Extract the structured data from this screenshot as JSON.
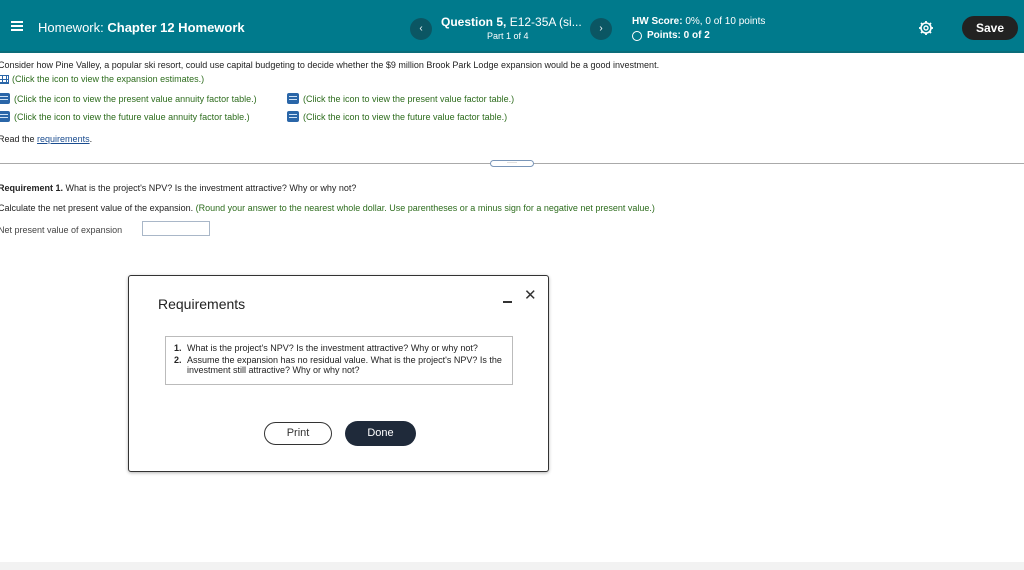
{
  "header": {
    "hw_prefix": "Homework:",
    "hw_name": "Chapter 12 Homework",
    "prev_label": "‹",
    "next_label": "›",
    "question_label": "Question 5,",
    "question_id": "E12-35A (si...",
    "part": "Part 1 of 4",
    "score_label": "HW Score:",
    "score_value": "0%, 0 of 10 points",
    "points_label": "Points:",
    "points_value": "0 of 2",
    "save_label": "Save"
  },
  "content": {
    "intro": "Consider how Pine Valley, a popular ski resort, could use capital budgeting to decide whether the $9 million Brook Park Lodge expansion would be a good investment.",
    "links": {
      "expansion": "(Click the icon to view the expansion estimates.)",
      "pv_annuity": "(Click the icon to view the present value annuity factor table.)",
      "pv_factor": "(Click the icon to view the present value factor table.)",
      "fv_annuity": "(Click the icon to view the future value annuity factor table.)",
      "fv_factor": "(Click the icon to view the future value factor table.)"
    },
    "read_prefix": "Read the",
    "read_link": "requirements",
    "read_suffix": ".",
    "divider_dots": "·····",
    "req1_label": "Requirement 1.",
    "req1_text": "What is the project's NPV? Is the investment attractive? Why or why not?",
    "calc_text": "Calculate the net present value of the expansion.",
    "calc_hint": "(Round your answer to the nearest whole dollar. Use parentheses or a minus sign for a negative net present value.)",
    "npv_label": "Net present value of expansion",
    "npv_value": ""
  },
  "modal": {
    "title": "Requirements",
    "items": [
      {
        "num": "1.",
        "text": "What is the project's NPV? Is the investment attractive? Why or why not?"
      },
      {
        "num": "2.",
        "text": "Assume the expansion has no residual value. What is the project's NPV? Is the investment still attractive? Why or why not?"
      }
    ],
    "print_label": "Print",
    "done_label": "Done",
    "close_label": "✕"
  }
}
